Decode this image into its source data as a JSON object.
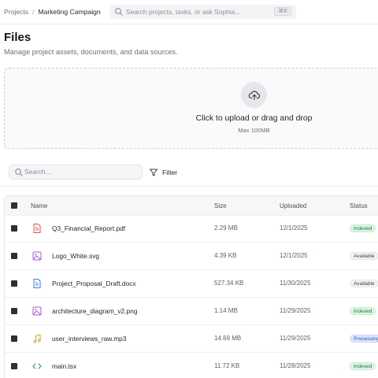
{
  "breadcrumb": {
    "root": "Projects",
    "separator": "/",
    "current": "Marketing Campaign"
  },
  "global_search": {
    "placeholder": "Search projects, tasks, or ask Sophia...",
    "shortcut": "⌘K"
  },
  "page": {
    "title": "Files",
    "subtitle": "Manage project assets, documents, and data sources."
  },
  "upload": {
    "title": "Click to upload or drag and drop",
    "limit": "Max 100MB",
    "icon": "upload-cloud-icon"
  },
  "toolbar": {
    "search_placeholder": "Search...",
    "filter_label": "Filter"
  },
  "table": {
    "columns": {
      "name": "Name",
      "size": "Size",
      "uploaded": "Uploaded",
      "status": "Status"
    },
    "rows": [
      {
        "icon": "pdf-file-icon",
        "icon_color": "#d9534f",
        "name": "Q3_Financial_Report.pdf",
        "size": "2.29 MB",
        "uploaded": "12/1/2025",
        "status": "Indexed"
      },
      {
        "icon": "image-file-icon",
        "icon_color": "#a35ad6",
        "name": "Logo_White.svg",
        "size": "4.39 KB",
        "uploaded": "12/1/2025",
        "status": "Available"
      },
      {
        "icon": "document-file-icon",
        "icon_color": "#3b7be0",
        "name": "Project_Proposal_Draft.docx",
        "size": "527.34 KB",
        "uploaded": "11/30/2025",
        "status": "Available"
      },
      {
        "icon": "image-file-icon",
        "icon_color": "#a35ad6",
        "name": "architecture_diagram_v2.png",
        "size": "1.14 MB",
        "uploaded": "11/29/2025",
        "status": "Indexed"
      },
      {
        "icon": "audio-file-icon",
        "icon_color": "#d9a21f",
        "name": "user_interviews_raw.mp3",
        "size": "14.69 MB",
        "uploaded": "11/29/2025",
        "status": "Processing"
      },
      {
        "icon": "code-file-icon",
        "icon_color": "#2e9a58",
        "name": "main.tsx",
        "size": "11.72 KB",
        "uploaded": "11/28/2025",
        "status": "Indexed"
      }
    ]
  },
  "colors": {
    "indexed": "#1d7a3c",
    "available": "#3d4249",
    "processing": "#2852b0"
  }
}
